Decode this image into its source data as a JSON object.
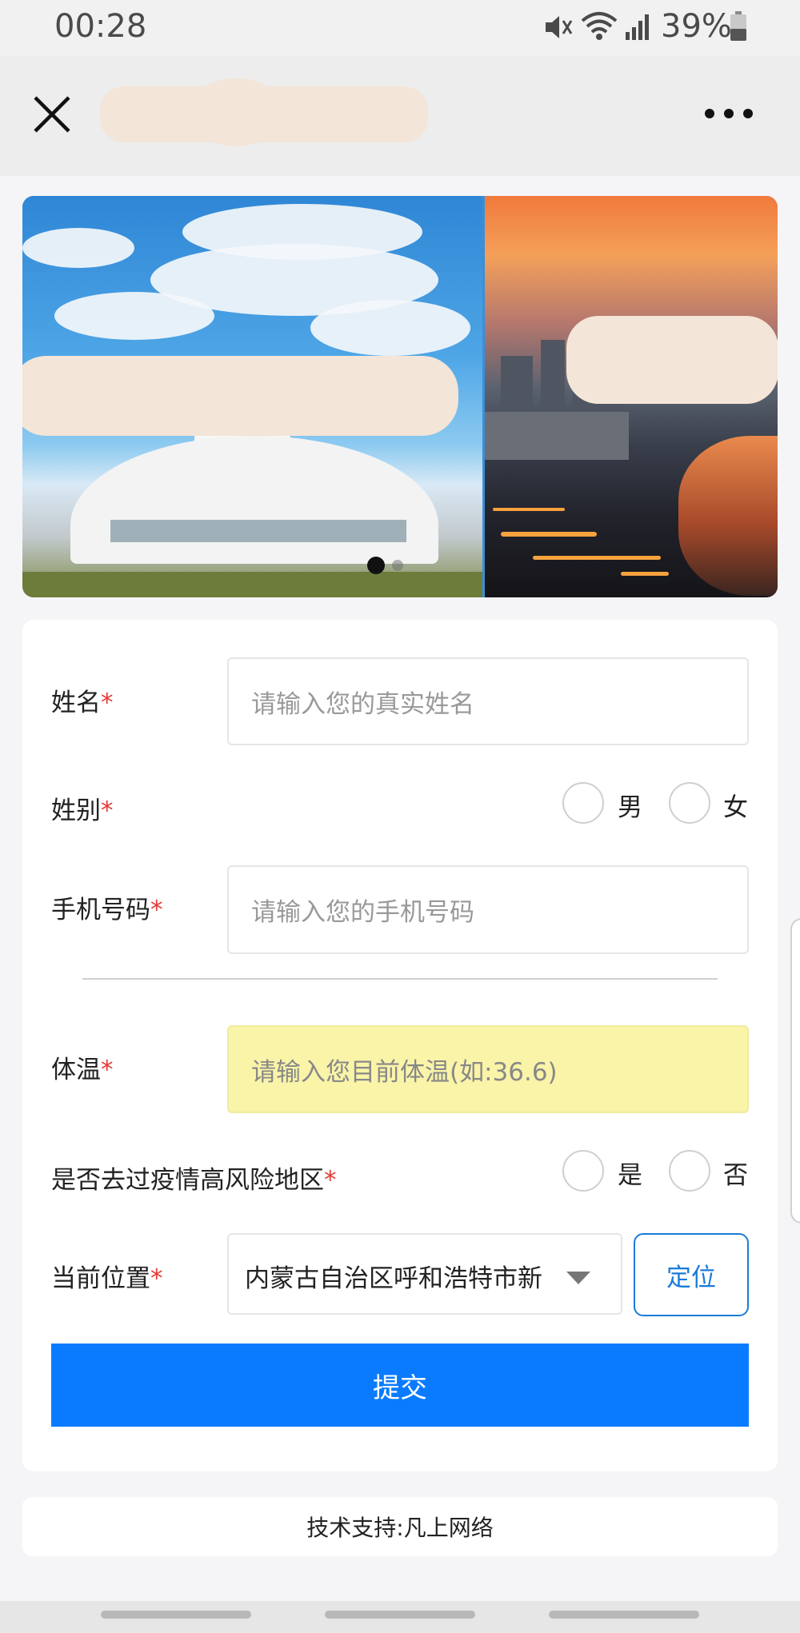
{
  "status_bar": {
    "time": "00:28",
    "battery": "39%"
  },
  "nav": {
    "title": ""
  },
  "banner": {
    "slides": 2,
    "active_index": 0
  },
  "form": {
    "name": {
      "label": "姓名",
      "required_mark": "*",
      "placeholder": "请输入您的真实姓名"
    },
    "gender": {
      "label": "姓别",
      "required_mark": "*",
      "options": [
        "男",
        "女"
      ]
    },
    "phone": {
      "label": "手机号码",
      "required_mark": "*",
      "placeholder": "请输入您的手机号码"
    },
    "temperature": {
      "label": "体温",
      "required_mark": "*",
      "placeholder": "请输入您目前体温(如:36.6)"
    },
    "risk_area": {
      "label": "是否去过疫情高风险地区",
      "required_mark": "*",
      "options": [
        "是",
        "否"
      ]
    },
    "location": {
      "label": "当前位置",
      "required_mark": "*",
      "value": "内蒙古自治区呼和浩特市新",
      "locate_button": "定位"
    },
    "submit_label": "提交"
  },
  "footer": {
    "text": "技术支持:凡上网络"
  },
  "colors": {
    "accent": "#0a7bff",
    "required": "#e53935",
    "temperature_bg": "#f9f4a8"
  }
}
